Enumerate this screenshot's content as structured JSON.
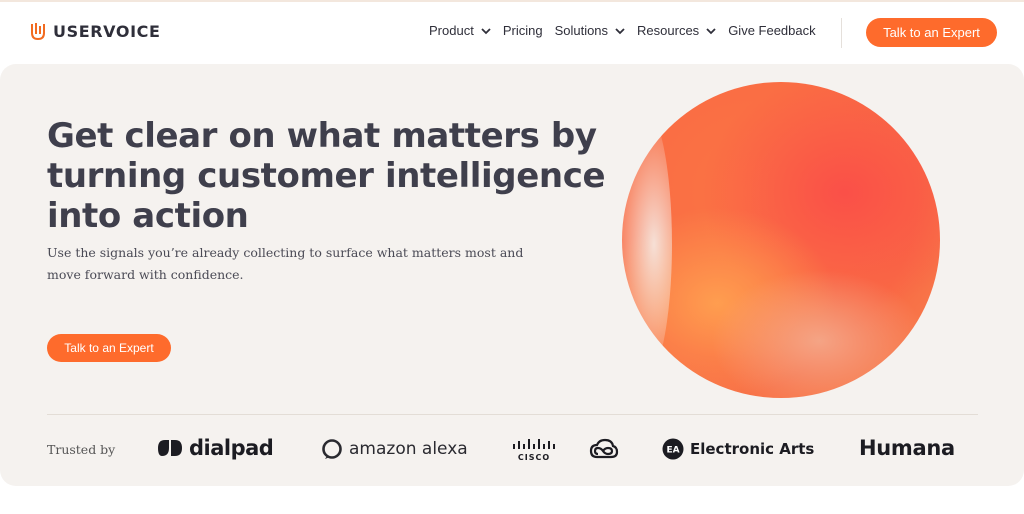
{
  "brand": {
    "name": "USERVOICE",
    "logo_icon": "uservoice-logo-icon"
  },
  "nav": {
    "items": [
      {
        "label": "Product",
        "has_dropdown": true
      },
      {
        "label": "Pricing",
        "has_dropdown": false
      },
      {
        "label": "Solutions",
        "has_dropdown": true
      },
      {
        "label": "Resources",
        "has_dropdown": true
      },
      {
        "label": "Give Feedback",
        "has_dropdown": false
      }
    ],
    "cta_label": "Talk to an Expert"
  },
  "hero": {
    "title": "Get clear on what matters by turning customer intelligence into action",
    "subtitle": "Use the signals you’re already collecting to surface what matters most and move forward with confidence.",
    "cta_label": "Talk to an Expert"
  },
  "trusted": {
    "label": "Trusted by",
    "logos": [
      {
        "name": "dialpad",
        "icon": "dialpad-logo-icon"
      },
      {
        "name": "amazon alexa",
        "icon": "alexa-ring-icon"
      },
      {
        "name": "CISCO",
        "icon": "cisco-bars-icon"
      },
      {
        "name": "",
        "icon": "creative-cloud-icon"
      },
      {
        "name": "Electronic Arts",
        "icon": "ea-badge-icon"
      },
      {
        "name": "Humana",
        "icon": ""
      }
    ]
  },
  "colors": {
    "accent": "#fe6b2c",
    "hero_background": "#f5f2ef",
    "text_dark": "#3f3f4c"
  }
}
